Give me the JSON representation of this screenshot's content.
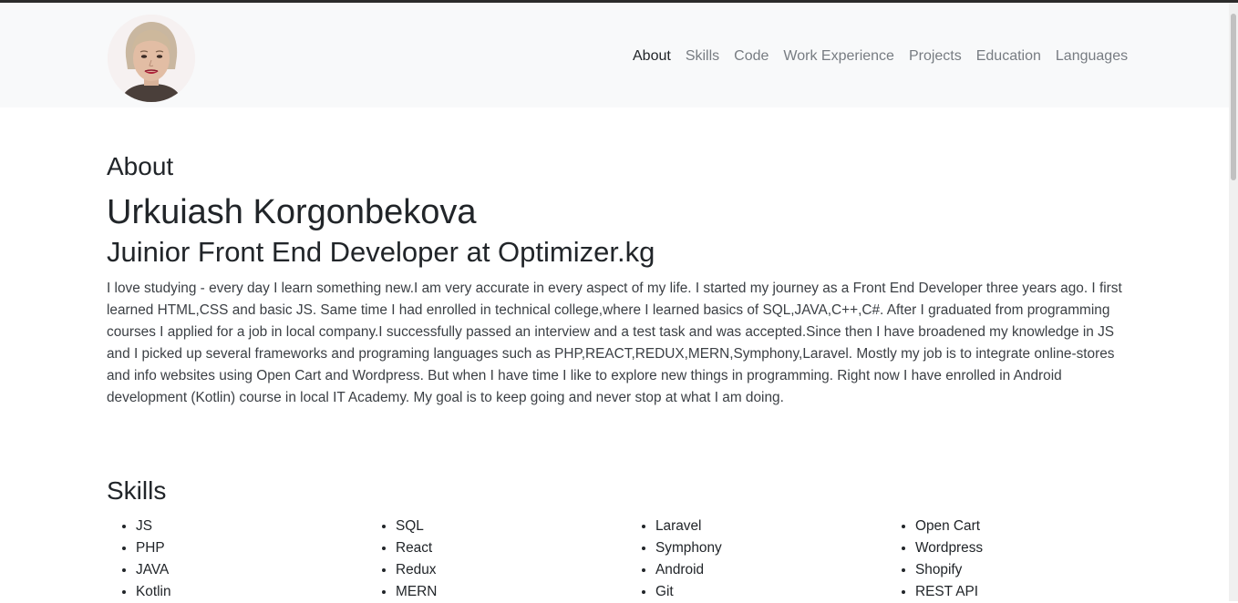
{
  "nav": {
    "items": [
      {
        "label": "About",
        "active": true
      },
      {
        "label": "Skills",
        "active": false
      },
      {
        "label": "Code",
        "active": false
      },
      {
        "label": "Work Experience",
        "active": false
      },
      {
        "label": "Projects",
        "active": false
      },
      {
        "label": "Education",
        "active": false
      },
      {
        "label": "Languages",
        "active": false
      }
    ]
  },
  "about": {
    "heading": "About",
    "name": "Urkuiash Korgonbekova",
    "role": "Juinior Front End Developer at Optimizer.kg",
    "bio": "I love studying - every day I learn something new.I am very accurate in every aspect of my life. I started my journey as a Front End Developer three years ago. I first learned HTML,CSS and basic JS. Same time I had enrolled in technical college,where I learned basics of SQL,JAVA,C++,C#. After I graduated from programming courses I applied for a job in local company.I successfully passed an interview and a test task and was accepted.Since then I have broadened my knowledge in JS and I picked up several frameworks and programing languages such as PHP,REACT,REDUX,MERN,Symphony,Laravel. Mostly my job is to integrate online-stores and info websites using Open Cart and Wordpress. But when I have time I like to explore new things in programming. Right now I have enrolled in Android development (Kotlin) course in local IT Academy. My goal is to keep going and never stop at what I am doing."
  },
  "skills": {
    "heading": "Skills",
    "columns": [
      [
        "JS",
        "PHP",
        "JAVA",
        "Kotlin"
      ],
      [
        "SQL",
        "React",
        "Redux",
        "MERN"
      ],
      [
        "Laravel",
        "Symphony",
        "Android",
        "Git"
      ],
      [
        "Open Cart",
        "Wordpress",
        "Shopify",
        "REST API"
      ]
    ]
  },
  "colors": {
    "navbar_bg": "#f8f9fa",
    "nav_link": "#777c82",
    "nav_active": "#212529",
    "text": "#212529"
  }
}
